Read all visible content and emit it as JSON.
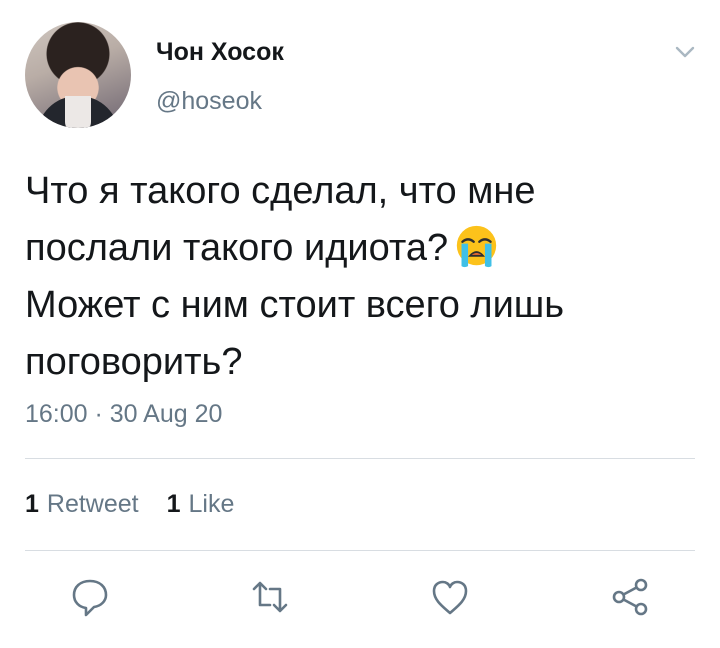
{
  "user": {
    "display_name": "Чон Хосок",
    "handle": "@hoseok"
  },
  "tweet": {
    "line1": "Что я такого сделал, что мне",
    "line2": "послали такого идиота?",
    "emoji": "loudly-crying-face-emoji",
    "line3": "Может с ним стоит всего лишь",
    "line4": "поговорить?",
    "timestamp": "16:00 · 30 Aug 20"
  },
  "stats": {
    "retweet_count": "1",
    "retweet_label": "Retweet",
    "like_count": "1",
    "like_label": "Like"
  },
  "icons": {
    "reply": "reply-icon",
    "retweet": "retweet-icon",
    "like": "heart-icon",
    "share": "share-icon",
    "menu": "chevron-down-icon"
  },
  "colors": {
    "text": "#14171a",
    "secondary": "#657786",
    "divider": "#d8dde2"
  }
}
